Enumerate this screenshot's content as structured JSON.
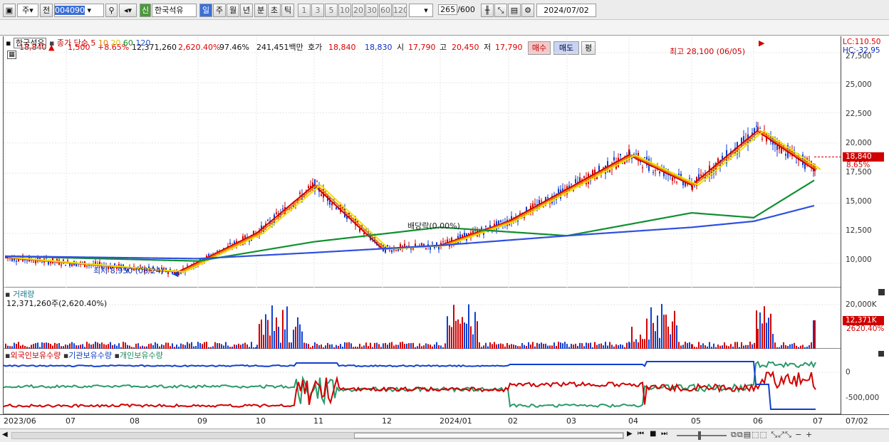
{
  "toolbar": {
    "market": "주",
    "prev": "전",
    "code": "004090",
    "badge": "신",
    "name": "한국석유",
    "periods": [
      "일",
      "주",
      "월",
      "년",
      "분",
      "초",
      "틱"
    ],
    "active_period": "일",
    "nums": [
      "1",
      "3",
      "5",
      "10",
      "20",
      "30",
      "60",
      "120"
    ],
    "count": "265",
    "total": "/600",
    "date": "2024/07/02"
  },
  "quote": {
    "price": "18,840",
    "arrow": "▲",
    "change": "1,500",
    "pct": "+8.65%",
    "volume": "12,371,260",
    "vol_pct": "2,620.40%",
    "ratio": "97.46%",
    "amount": "241,451백만",
    "hoga_label": "호가",
    "ask": "18,840",
    "bid": "18,830",
    "open_l": "시",
    "open": "17,790",
    "high_l": "고",
    "high": "20,450",
    "low_l": "저",
    "low": "17,790",
    "buy": "매수",
    "sell": "매도",
    "avg": "평"
  },
  "legend": {
    "name": "한국석유",
    "ma": "종가 단순",
    "p5": "5",
    "p10": "10",
    "p20": "20",
    "p60": "60",
    "p120": "120"
  },
  "price_axis": {
    "lc": "LC:110.50",
    "hc": "HC:-32.95",
    "ticks": [
      "27,500",
      "25,000",
      "22,500",
      "20,000",
      "17,500",
      "15,000",
      "12,500",
      "10,000"
    ],
    "cur": "18,840",
    "cur_pct": "8.65%"
  },
  "annotations": {
    "high": "최고 28,100 (06/05)",
    "low": "최저 8,950 (08/24)",
    "div": "배당락(0.00%)"
  },
  "volume": {
    "title": "거래량",
    "value": "12,371,260주(2,620.40%)",
    "tick": "20,000K",
    "cur": "12,371K",
    "cur_pct": "2620.40%"
  },
  "holdings": {
    "title1": "외국인보유수량",
    "title2": "기관보유수량",
    "title3": "개인보유수량",
    "ticks": [
      "0",
      "-500,000"
    ]
  },
  "xaxis": {
    "labels": [
      "2023/06",
      "07",
      "08",
      "09",
      "10",
      "11",
      "12",
      "2024/01",
      "02",
      "03",
      "04",
      "05",
      "06",
      "07"
    ],
    "end": "07/02"
  },
  "colors": {
    "up": "#d00000",
    "down": "#1040d0",
    "ma5": "#d00000",
    "ma10": "#f08000",
    "ma20": "#f0e000",
    "ma60": "#109030",
    "ma120": "#3050e0"
  },
  "chart_data": {
    "type": "line",
    "title": "한국석유",
    "series": [
      {
        "name": "5",
        "x": [
          "2023/06",
          "2023/08/24",
          "2023/10",
          "2023/11",
          "2023/12",
          "2024/01",
          "2024/02",
          "2024/04",
          "2024/05",
          "2024/06/05",
          "2024/07/02"
        ],
        "values": [
          10500,
          9300,
          12500,
          16500,
          11200,
          11500,
          13500,
          19000,
          16500,
          21000,
          17800
        ]
      },
      {
        "name": "60",
        "x": [
          "2023/06",
          "2023/09",
          "2023/11",
          "2024/01",
          "2024/03",
          "2024/05",
          "2024/06",
          "2024/07/02"
        ],
        "values": [
          10600,
          10200,
          11800,
          13000,
          12300,
          14200,
          13800,
          16900
        ]
      },
      {
        "name": "120",
        "x": [
          "2023/06",
          "2023/09",
          "2023/11",
          "2024/01",
          "2024/03",
          "2024/05",
          "2024/06",
          "2024/07/02"
        ],
        "values": [
          10600,
          10400,
          10900,
          11500,
          12300,
          13000,
          13500,
          14800
        ]
      }
    ],
    "ylim": [
      8000,
      28500
    ]
  }
}
